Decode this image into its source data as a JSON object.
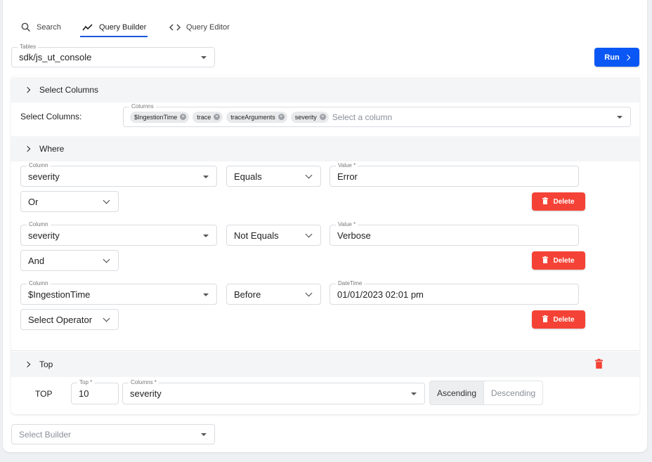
{
  "tabs": [
    {
      "label": "Search",
      "icon": "search-icon"
    },
    {
      "label": "Query Builder",
      "icon": "chart-line-icon",
      "active": true
    },
    {
      "label": "Query Editor",
      "icon": "code-icon"
    }
  ],
  "tables": {
    "label": "Tables",
    "value": "sdk/js_ut_console"
  },
  "run_button": {
    "label": "Run"
  },
  "select_columns": {
    "header": "Select Columns",
    "row_label": "Select Columns:",
    "field_label": "Columns",
    "chips": [
      "$IngestionTime",
      "trace",
      "traceArguments",
      "severity"
    ],
    "placeholder": "Select a column"
  },
  "where": {
    "header": "Where",
    "column_label": "Column",
    "conditions": [
      {
        "column": "severity",
        "operator": "Equals",
        "value_label": "Value *",
        "value": "Error",
        "joiner": "Or"
      },
      {
        "column": "severity",
        "operator": "Not Equals",
        "value_label": "Value *",
        "value": "Verbose",
        "joiner": "And"
      },
      {
        "column": "$IngestionTime",
        "operator": "Before",
        "value_label": "DateTime",
        "value": "01/01/2023 02:01 pm",
        "joiner": "Select Operator"
      }
    ],
    "delete_label": "Delete"
  },
  "top": {
    "header": "Top",
    "row_label": "TOP",
    "top_label": "Top *",
    "top_value": "10",
    "columns_label": "Columns *",
    "columns_value": "severity",
    "sort_options": [
      "Ascending",
      "Descending"
    ],
    "sort_selected": "Ascending"
  },
  "builder": {
    "placeholder": "Select Builder"
  },
  "colors": {
    "accent": "#0b57f5",
    "delete": "#f44336",
    "tab_underline": "#1a56db"
  }
}
